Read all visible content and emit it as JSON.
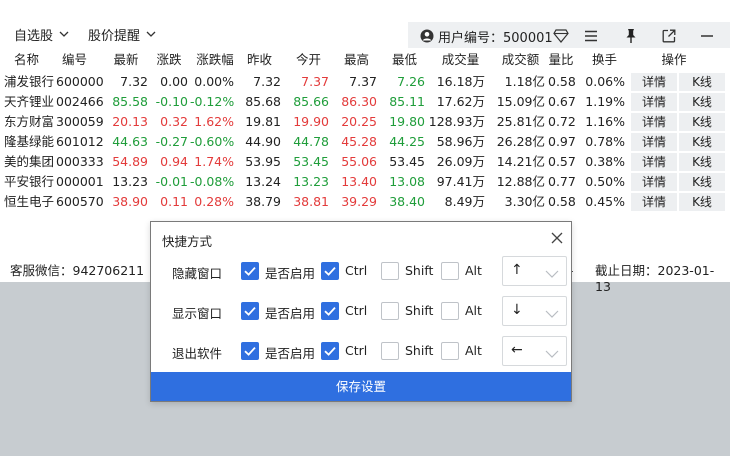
{
  "menu": {
    "watchlist_label": "自选股",
    "alert_label": "股价提醒"
  },
  "user": {
    "id_text": "用户编号：500001"
  },
  "toolbar_icons": [
    "user-icon",
    "diamond-icon",
    "menu-icon",
    "pin-icon",
    "popout-icon",
    "minimize-icon",
    "close-icon"
  ],
  "table": {
    "headers": [
      "名称",
      "编号",
      "最新",
      "涨跌",
      "涨跌幅",
      "昨收",
      "今开",
      "最高",
      "最低",
      "成交量",
      "成交额",
      "量比",
      "换手",
      "操作"
    ],
    "detail_label": "详情",
    "kline_label": "K线",
    "rows": [
      {
        "name": "浦发银行",
        "code": "600000",
        "latest": "7.32",
        "change": "0.00",
        "change_pct": "0.00%",
        "prev_close": "7.32",
        "open": "7.37",
        "high": "7.37",
        "low": "7.26",
        "volume": "16.18万",
        "amount": "1.18亿",
        "vol_ratio": "0.58",
        "turnover": "0.06%",
        "colors": {
          "latest": "flat",
          "change": "flat",
          "change_pct": "flat",
          "open": "up",
          "high": "flat",
          "low": "down"
        }
      },
      {
        "name": "天齐锂业",
        "code": "002466",
        "latest": "85.58",
        "change": "-0.10",
        "change_pct": "-0.12%",
        "prev_close": "85.68",
        "open": "85.66",
        "high": "86.30",
        "low": "85.11",
        "volume": "17.62万",
        "amount": "15.09亿",
        "vol_ratio": "0.67",
        "turnover": "1.19%",
        "colors": {
          "latest": "down",
          "change": "down",
          "change_pct": "down",
          "open": "down",
          "high": "up",
          "low": "down"
        }
      },
      {
        "name": "东方财富",
        "code": "300059",
        "latest": "20.13",
        "change": "0.32",
        "change_pct": "1.62%",
        "prev_close": "19.81",
        "open": "19.90",
        "high": "20.25",
        "low": "19.80",
        "volume": "128.93万",
        "amount": "25.81亿",
        "vol_ratio": "0.72",
        "turnover": "1.16%",
        "colors": {
          "latest": "up",
          "change": "up",
          "change_pct": "up",
          "open": "up",
          "high": "up",
          "low": "down"
        }
      },
      {
        "name": "隆基绿能",
        "code": "601012",
        "latest": "44.63",
        "change": "-0.27",
        "change_pct": "-0.60%",
        "prev_close": "44.90",
        "open": "44.78",
        "high": "45.28",
        "low": "44.25",
        "volume": "58.96万",
        "amount": "26.28亿",
        "vol_ratio": "0.97",
        "turnover": "0.78%",
        "colors": {
          "latest": "down",
          "change": "down",
          "change_pct": "down",
          "open": "down",
          "high": "up",
          "low": "down"
        }
      },
      {
        "name": "美的集团",
        "code": "000333",
        "latest": "54.89",
        "change": "0.94",
        "change_pct": "1.74%",
        "prev_close": "53.95",
        "open": "53.45",
        "high": "55.06",
        "low": "53.45",
        "volume": "26.09万",
        "amount": "14.21亿",
        "vol_ratio": "0.57",
        "turnover": "0.38%",
        "colors": {
          "latest": "up",
          "change": "up",
          "change_pct": "up",
          "open": "down",
          "high": "up",
          "low": "flat"
        }
      },
      {
        "name": "平安银行",
        "code": "000001",
        "latest": "13.23",
        "change": "-0.01",
        "change_pct": "-0.08%",
        "prev_close": "13.24",
        "open": "13.23",
        "high": "13.40",
        "low": "13.08",
        "volume": "97.41万",
        "amount": "12.88亿",
        "vol_ratio": "0.77",
        "turnover": "0.50%",
        "colors": {
          "latest": "flat",
          "change": "down",
          "change_pct": "down",
          "open": "down",
          "high": "up",
          "low": "down"
        }
      },
      {
        "name": "恒生电子",
        "code": "600570",
        "latest": "38.90",
        "change": "0.11",
        "change_pct": "0.28%",
        "prev_close": "38.79",
        "open": "38.81",
        "high": "39.29",
        "low": "38.40",
        "volume": "8.49万",
        "amount": "3.30亿",
        "vol_ratio": "0.58",
        "turnover": "0.45%",
        "colors": {
          "latest": "up",
          "change": "up",
          "change_pct": "up",
          "open": "up",
          "high": "up",
          "low": "down"
        }
      }
    ]
  },
  "status": {
    "wechat": "客服微信：942706211",
    "partial": "1",
    "expiry": "截止日期：2023-01-13"
  },
  "dialog": {
    "title": "快捷方式",
    "enable_label": "是否启用",
    "ctrl_label": "Ctrl",
    "shift_label": "Shift",
    "alt_label": "Alt",
    "rows": [
      {
        "label": "隐藏窗口",
        "enabled": true,
        "ctrl": true,
        "shift": false,
        "alt": false,
        "key": "↑"
      },
      {
        "label": "显示窗口",
        "enabled": true,
        "ctrl": true,
        "shift": false,
        "alt": false,
        "key": "↓"
      },
      {
        "label": "退出软件",
        "enabled": true,
        "ctrl": true,
        "shift": false,
        "alt": false,
        "key": "←"
      }
    ],
    "save_label": "保存设置"
  },
  "colors": {
    "up": "#e33b3b",
    "down": "#1f9d3a",
    "accent": "#2f6fe0"
  }
}
